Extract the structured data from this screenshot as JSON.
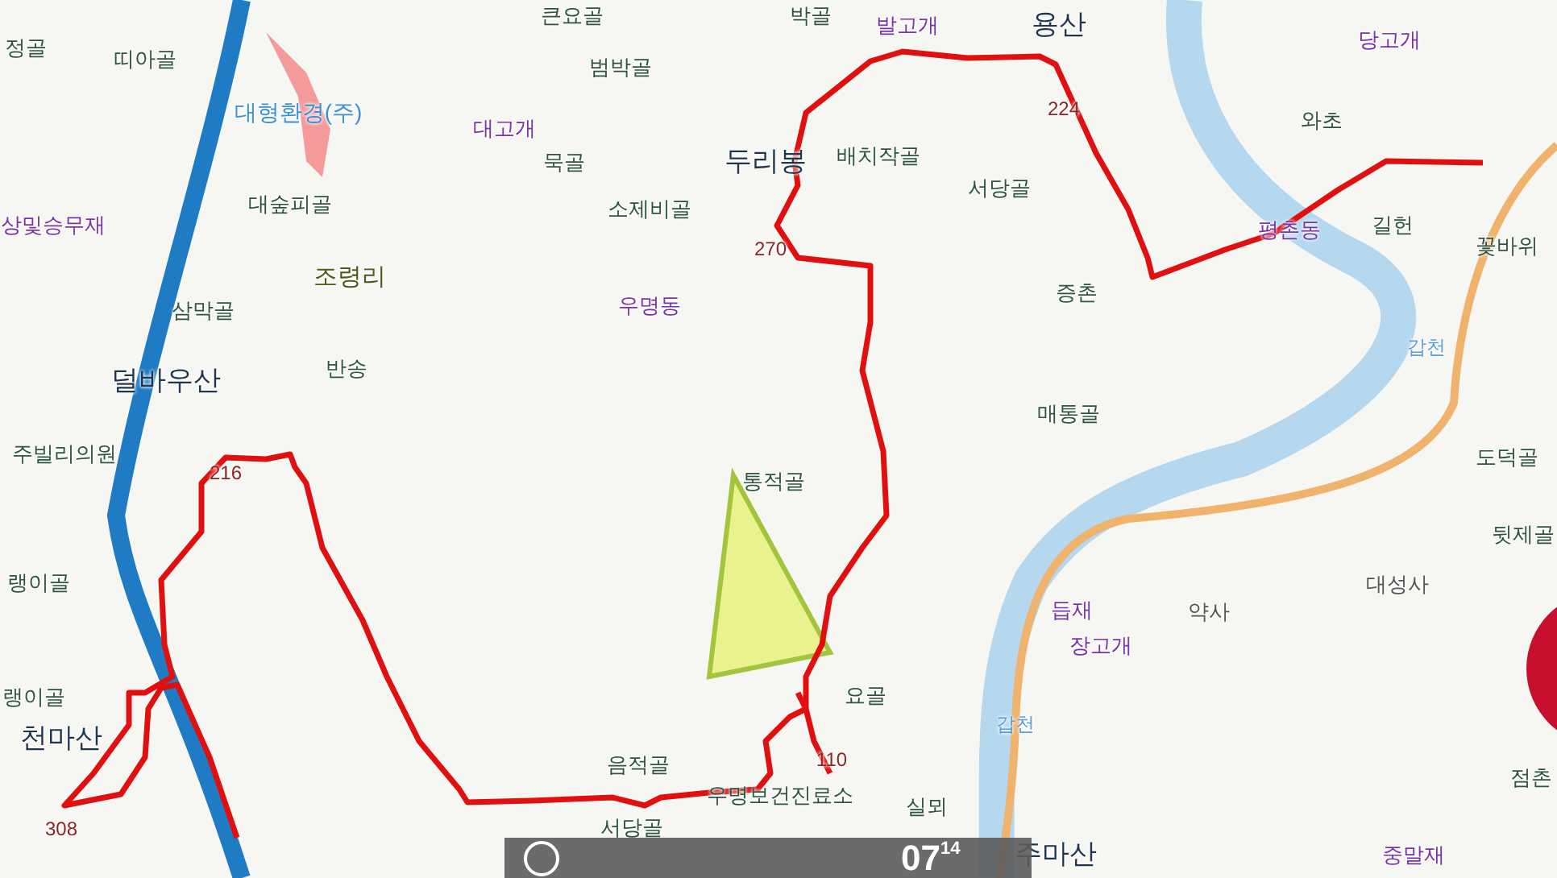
{
  "map": {
    "labels": [
      {
        "text": "정골",
        "kind": "place"
      },
      {
        "text": "띠아골",
        "kind": "place"
      },
      {
        "text": "큰요골",
        "kind": "place"
      },
      {
        "text": "박골",
        "kind": "place"
      },
      {
        "text": "발고개",
        "kind": "pass"
      },
      {
        "text": "용산",
        "kind": "mountain"
      },
      {
        "text": "당고개",
        "kind": "pass"
      },
      {
        "text": "대형환경(주)",
        "kind": "facility"
      },
      {
        "text": "대고개",
        "kind": "pass"
      },
      {
        "text": "범박골",
        "kind": "place"
      },
      {
        "text": "묵골",
        "kind": "place"
      },
      {
        "text": "두리봉",
        "kind": "mountain"
      },
      {
        "text": "배치작골",
        "kind": "place"
      },
      {
        "text": "와초",
        "kind": "place"
      },
      {
        "text": "224",
        "kind": "elevation"
      },
      {
        "text": "대숲피골",
        "kind": "place"
      },
      {
        "text": "상및승무재",
        "kind": "pass"
      },
      {
        "text": "소제비골",
        "kind": "place"
      },
      {
        "text": "서당골",
        "kind": "place"
      },
      {
        "text": "270",
        "kind": "elevation"
      },
      {
        "text": "평촌동",
        "kind": "pass"
      },
      {
        "text": "길헌",
        "kind": "place"
      },
      {
        "text": "꽃바위",
        "kind": "place"
      },
      {
        "text": "조령리",
        "kind": "village"
      },
      {
        "text": "삼막골",
        "kind": "place"
      },
      {
        "text": "우명동",
        "kind": "pass"
      },
      {
        "text": "증촌",
        "kind": "place"
      },
      {
        "text": "갑천",
        "kind": "stream"
      },
      {
        "text": "덜바우산",
        "kind": "mountain"
      },
      {
        "text": "반송",
        "kind": "place"
      },
      {
        "text": "매통골",
        "kind": "place"
      },
      {
        "text": "주빌리의원",
        "kind": "place"
      },
      {
        "text": "216",
        "kind": "elevation"
      },
      {
        "text": "통적골",
        "kind": "place"
      },
      {
        "text": "도덕골",
        "kind": "place"
      },
      {
        "text": "뒷제골",
        "kind": "place"
      },
      {
        "text": "랭이골",
        "kind": "place"
      },
      {
        "text": "대성사",
        "kind": "facility2"
      },
      {
        "text": "듭재",
        "kind": "pass"
      },
      {
        "text": "장고개",
        "kind": "pass"
      },
      {
        "text": "약사",
        "kind": "facility2"
      },
      {
        "text": "랭이골",
        "kind": "place"
      },
      {
        "text": "천마산",
        "kind": "mountain"
      },
      {
        "text": "요골",
        "kind": "place"
      },
      {
        "text": "갑천",
        "kind": "stream"
      },
      {
        "text": "110",
        "kind": "elevation"
      },
      {
        "text": "음적골",
        "kind": "place"
      },
      {
        "text": "실뫼",
        "kind": "place"
      },
      {
        "text": "우명보건진료소",
        "kind": "place"
      },
      {
        "text": "308",
        "kind": "elevation"
      },
      {
        "text": "서당골",
        "kind": "place"
      },
      {
        "text": "주마산",
        "kind": "mountain"
      },
      {
        "text": "중말재",
        "kind": "pass"
      },
      {
        "text": "점촌",
        "kind": "place"
      }
    ]
  },
  "overlay": {
    "hours": "07",
    "minutes": "14"
  }
}
